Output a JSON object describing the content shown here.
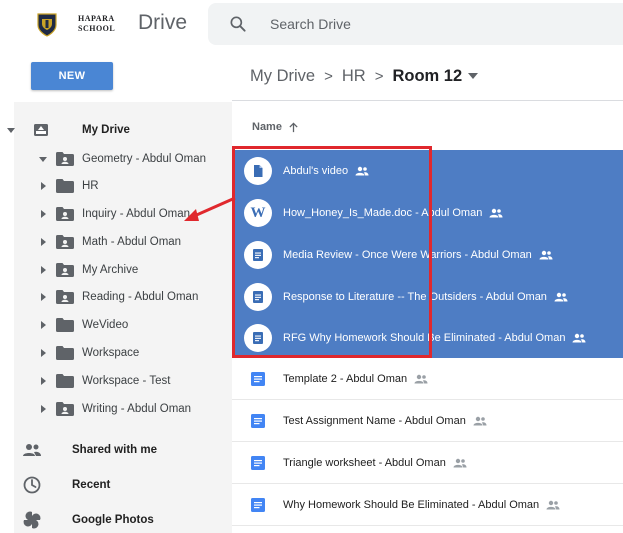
{
  "header": {
    "school_line1": "HAPARA",
    "school_line2": "SCHOOL",
    "app_name": "Drive",
    "search_placeholder": "Search Drive"
  },
  "sidebar": {
    "new_label": "NEW",
    "root_label": "My Drive",
    "folders": [
      {
        "label": "Geometry - Abdul Oman",
        "shared": true,
        "expanded": true
      },
      {
        "label": "HR",
        "shared": false,
        "expanded": false
      },
      {
        "label": "Inquiry - Abdul Oman",
        "shared": true,
        "expanded": false
      },
      {
        "label": "Math - Abdul Oman",
        "shared": true,
        "expanded": false
      },
      {
        "label": "My Archive",
        "shared": true,
        "expanded": false
      },
      {
        "label": "Reading - Abdul Oman",
        "shared": true,
        "expanded": false
      },
      {
        "label": "WeVideo",
        "shared": false,
        "expanded": false
      },
      {
        "label": "Workspace",
        "shared": false,
        "expanded": false
      },
      {
        "label": "Workspace - Test",
        "shared": false,
        "expanded": false
      },
      {
        "label": "Writing - Abdul Oman",
        "shared": true,
        "expanded": false
      }
    ],
    "nav_items": [
      {
        "label": "Shared with me",
        "icon": "people-icon"
      },
      {
        "label": "Recent",
        "icon": "clock-icon"
      },
      {
        "label": "Google Photos",
        "icon": "pinwheel-icon"
      }
    ]
  },
  "breadcrumb": {
    "items": [
      "My Drive",
      "HR"
    ],
    "separator": ">",
    "current": "Room 12"
  },
  "list": {
    "name_header": "Name",
    "files": [
      {
        "name": "Abdul's video",
        "type": "file",
        "selected": true
      },
      {
        "name": "How_Honey_Is_Made.doc - Abdul Oman",
        "type": "word",
        "selected": true
      },
      {
        "name": "Media Review - Once Were Warriors - Abdul Oman",
        "type": "doc",
        "selected": true
      },
      {
        "name": "Response to Literature -- The Outsiders - Abdul Oman",
        "type": "doc",
        "selected": true
      },
      {
        "name": "RFG Why Homework Should Be Eliminated - Abdul Oman",
        "type": "doc",
        "selected": true
      },
      {
        "name": "Template 2 - Abdul Oman",
        "type": "doc",
        "selected": false
      },
      {
        "name": "Test Assignment Name - Abdul Oman",
        "type": "doc",
        "selected": false
      },
      {
        "name": "Triangle worksheet - Abdul Oman",
        "type": "doc",
        "selected": false
      },
      {
        "name": "Why Homework Should Be Eliminated - Abdul Oman",
        "type": "doc",
        "selected": false
      }
    ]
  },
  "colors": {
    "accent": "#4a86d4",
    "selection": "#4e7dc4",
    "annotation": "#e0282d",
    "doc_blue": "#4285f4"
  }
}
